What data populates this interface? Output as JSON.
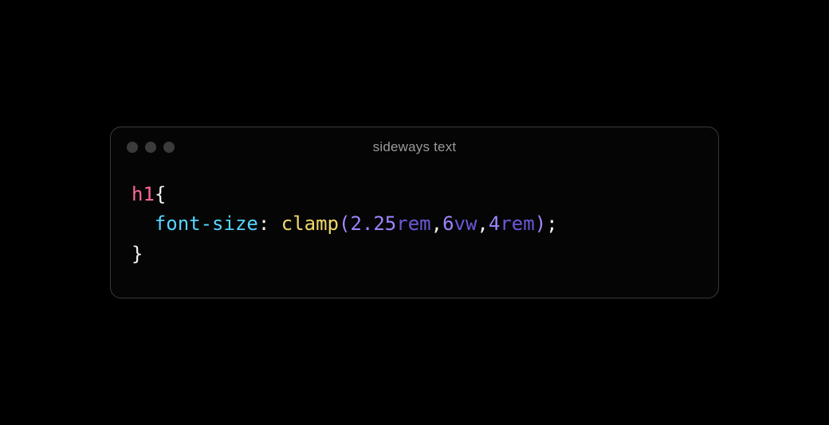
{
  "window": {
    "title": "sideways text"
  },
  "code": {
    "line1": {
      "selector": "h1",
      "brace_open": "{"
    },
    "line2": {
      "property": "font-size",
      "colon": ":",
      "func": "clamp",
      "paren_open": "(",
      "arg1_num": "2.25",
      "arg1_unit": "rem",
      "comma1": ",",
      "arg2_num": "6",
      "arg2_unit": "vw",
      "comma2": ",",
      "arg3_num": "4",
      "arg3_unit": "rem",
      "paren_close": ")",
      "semicolon": ";"
    },
    "line3": {
      "brace_close": "}"
    }
  }
}
